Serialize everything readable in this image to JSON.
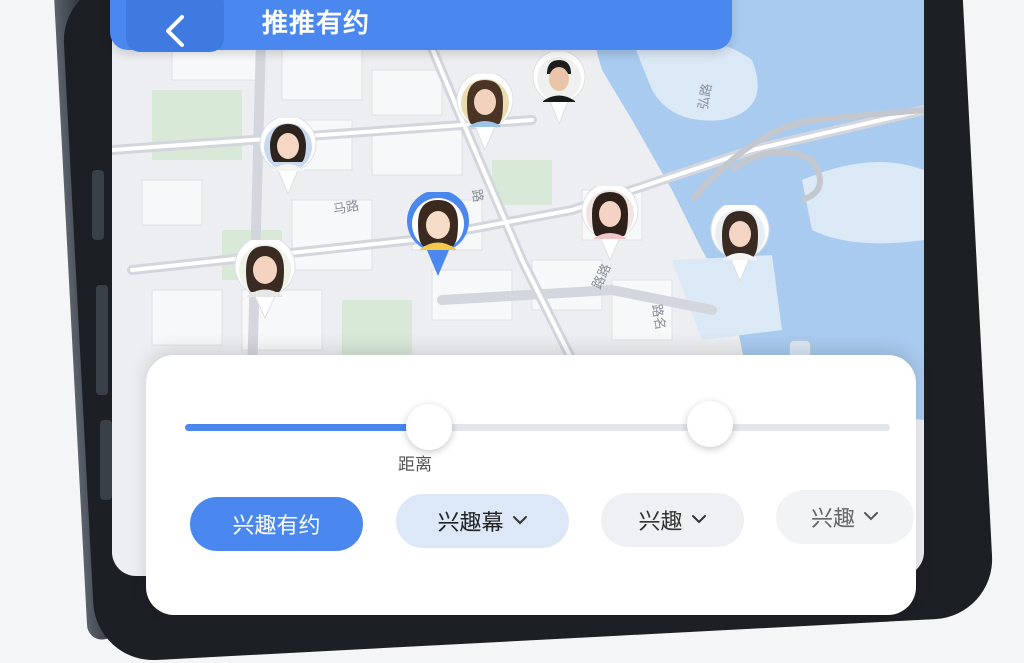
{
  "header": {
    "title": "推推有约",
    "back_icon": "chevron-left-icon",
    "bg_color": "#4a88f0"
  },
  "map": {
    "road_labels": [
      "马路",
      "弘路",
      "路",
      "路路",
      "路名"
    ]
  },
  "slider": {
    "label": "距离",
    "accent_color": "#4a88f0"
  },
  "filters": [
    {
      "label": "兴趣有约",
      "state": "selected"
    },
    {
      "label": "兴趣幕",
      "icon": "chevron-down-icon"
    },
    {
      "label": "兴趣",
      "icon": "chevron-down-icon"
    },
    {
      "label": "兴趣",
      "icon": "chevron-down-icon"
    }
  ]
}
